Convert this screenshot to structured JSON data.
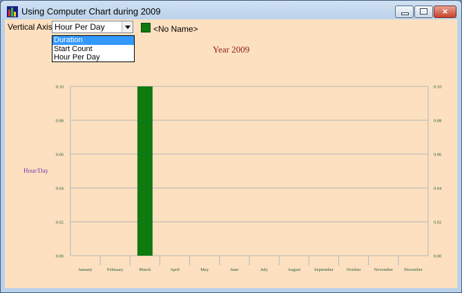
{
  "window": {
    "title": "Using Computer Chart during 2009",
    "controls": {
      "minimize": "minimize",
      "maximize": "maximize",
      "close": "×"
    }
  },
  "toolbar": {
    "vertical_axis_label": "Vertical Axis",
    "selected": "Hour Per Day",
    "options": [
      "Duration",
      "Start Count",
      "Hour Per Day"
    ],
    "highlighted_option": "Duration",
    "legend_label": "<No Name>",
    "legend_color": "#0f7a0f"
  },
  "chart_data": {
    "type": "bar",
    "title": "Year  2009",
    "ylabel": "Hour/Day",
    "xlabel": "",
    "categories": [
      "January",
      "February",
      "March",
      "April",
      "May",
      "June",
      "July",
      "August",
      "September",
      "October",
      "November",
      "December"
    ],
    "series": [
      {
        "name": "<No Name>",
        "color": "#0f7a0f",
        "values": [
          0,
          0,
          0.1,
          0,
          0,
          0,
          0,
          0,
          0,
          0,
          0,
          0
        ]
      }
    ],
    "ylim": [
      0,
      0.1
    ],
    "yticks": [
      "0.00",
      "0.02",
      "0.04",
      "0.06",
      "0.08",
      "0.10"
    ],
    "grid": true,
    "colors": {
      "tick_text": "#1a5a3a",
      "title": "#8b1a1a",
      "ylabel": "#7733aa",
      "grid": "#b0b8b8"
    }
  }
}
